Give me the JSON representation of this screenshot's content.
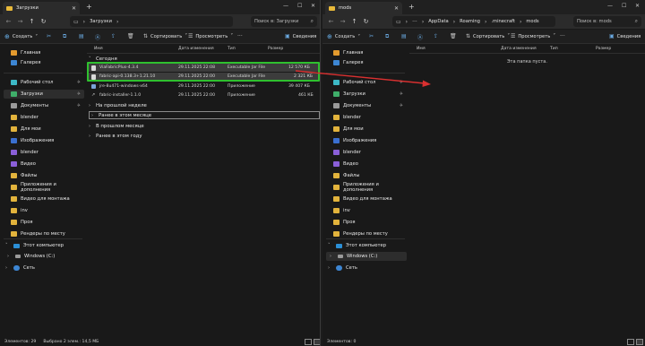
{
  "left": {
    "tab_title": "Загрузки",
    "path": [
      "Загрузки"
    ],
    "search_placeholder": "Поиск в: Загрузки",
    "toolbar": {
      "new": "Создать",
      "sort": "Сортировать",
      "view": "Просмотреть",
      "details": "Сведения"
    },
    "sidebar": {
      "top": [
        {
          "label": "Главная",
          "icon": "home-icon"
        },
        {
          "label": "Галерея",
          "icon": "gallery-icon"
        }
      ],
      "pinned": [
        {
          "label": "Рабочий стол",
          "icon": "desktop-folder-icon",
          "pinned": true
        },
        {
          "label": "Загрузки",
          "icon": "downloads-folder-icon",
          "pinned": true,
          "selected": true
        },
        {
          "label": "Документы",
          "icon": "documents-folder-icon",
          "pinned": true
        },
        {
          "label": "blender",
          "icon": "folder-icon"
        },
        {
          "label": "Для мои",
          "icon": "folder-icon"
        },
        {
          "label": "Изображения",
          "icon": "pictures-folder-icon"
        },
        {
          "label": "blender",
          "icon": "folder-icon"
        },
        {
          "label": "Видео",
          "icon": "videos-folder-icon"
        },
        {
          "label": "Файлы",
          "icon": "folder-icon"
        },
        {
          "label": "Приложения и дополнения",
          "icon": "folder-icon"
        },
        {
          "label": "Видео для монтажа",
          "icon": "folder-icon"
        },
        {
          "label": "inv",
          "icon": "folder-icon"
        },
        {
          "label": "Проя",
          "icon": "folder-icon"
        },
        {
          "label": "Рендеры по месту",
          "icon": "folder-icon"
        }
      ],
      "computer": "Этот компьютер",
      "drive": "Windows (C:)",
      "network": "Сеть"
    },
    "columns": [
      "Имя",
      "Дата изменения",
      "Тип",
      "Размер"
    ],
    "groups": {
      "today": "Сегодня",
      "last_week": "На прошлой неделе",
      "earlier_month": "Ранее в этом месяце",
      "last_month": "В прошлом месяце",
      "earlier_year": "Ранее в этом году"
    },
    "files": [
      {
        "name": "ViaFabricPlus-4.3.4",
        "date": "29.11.2025 22:08",
        "type": "Executable Jar File",
        "size": "12 570 КБ",
        "icon": "jar-file-icon",
        "selected": true
      },
      {
        "name": "fabric-api-0.138.3+1.21.10",
        "date": "29.11.2025 22:00",
        "type": "Executable Jar File",
        "size": "2 321 КБ",
        "icon": "jar-file-icon",
        "selected": true
      },
      {
        "name": "jre-8u471-windows-x64",
        "date": "29.11.2025 22:00",
        "type": "Приложение",
        "size": "39 407 КБ",
        "icon": "installer-icon"
      },
      {
        "name": "fabric-installer-1.1.0",
        "date": "29.11.2025 22:00",
        "type": "Приложение",
        "size": "461 КБ",
        "icon": "shortcut-icon"
      }
    ],
    "status": {
      "count": "Элементов: 29",
      "selected": "Выбрано 2 элем.: 14,5 МБ"
    }
  },
  "right": {
    "tab_title": "mods",
    "path": [
      "AppData",
      "Roaming",
      ".minecraft",
      "mods"
    ],
    "search_placeholder": "Поиск в: mods",
    "toolbar": {
      "new": "Создать",
      "sort": "Сортировать",
      "view": "Просмотреть",
      "details": "Сведения"
    },
    "empty_text": "Эта папка пуста.",
    "status": {
      "count": "Элементов: 0"
    }
  },
  "colors": {
    "highlight": "#2fc02f",
    "arrow": "#d93030"
  }
}
